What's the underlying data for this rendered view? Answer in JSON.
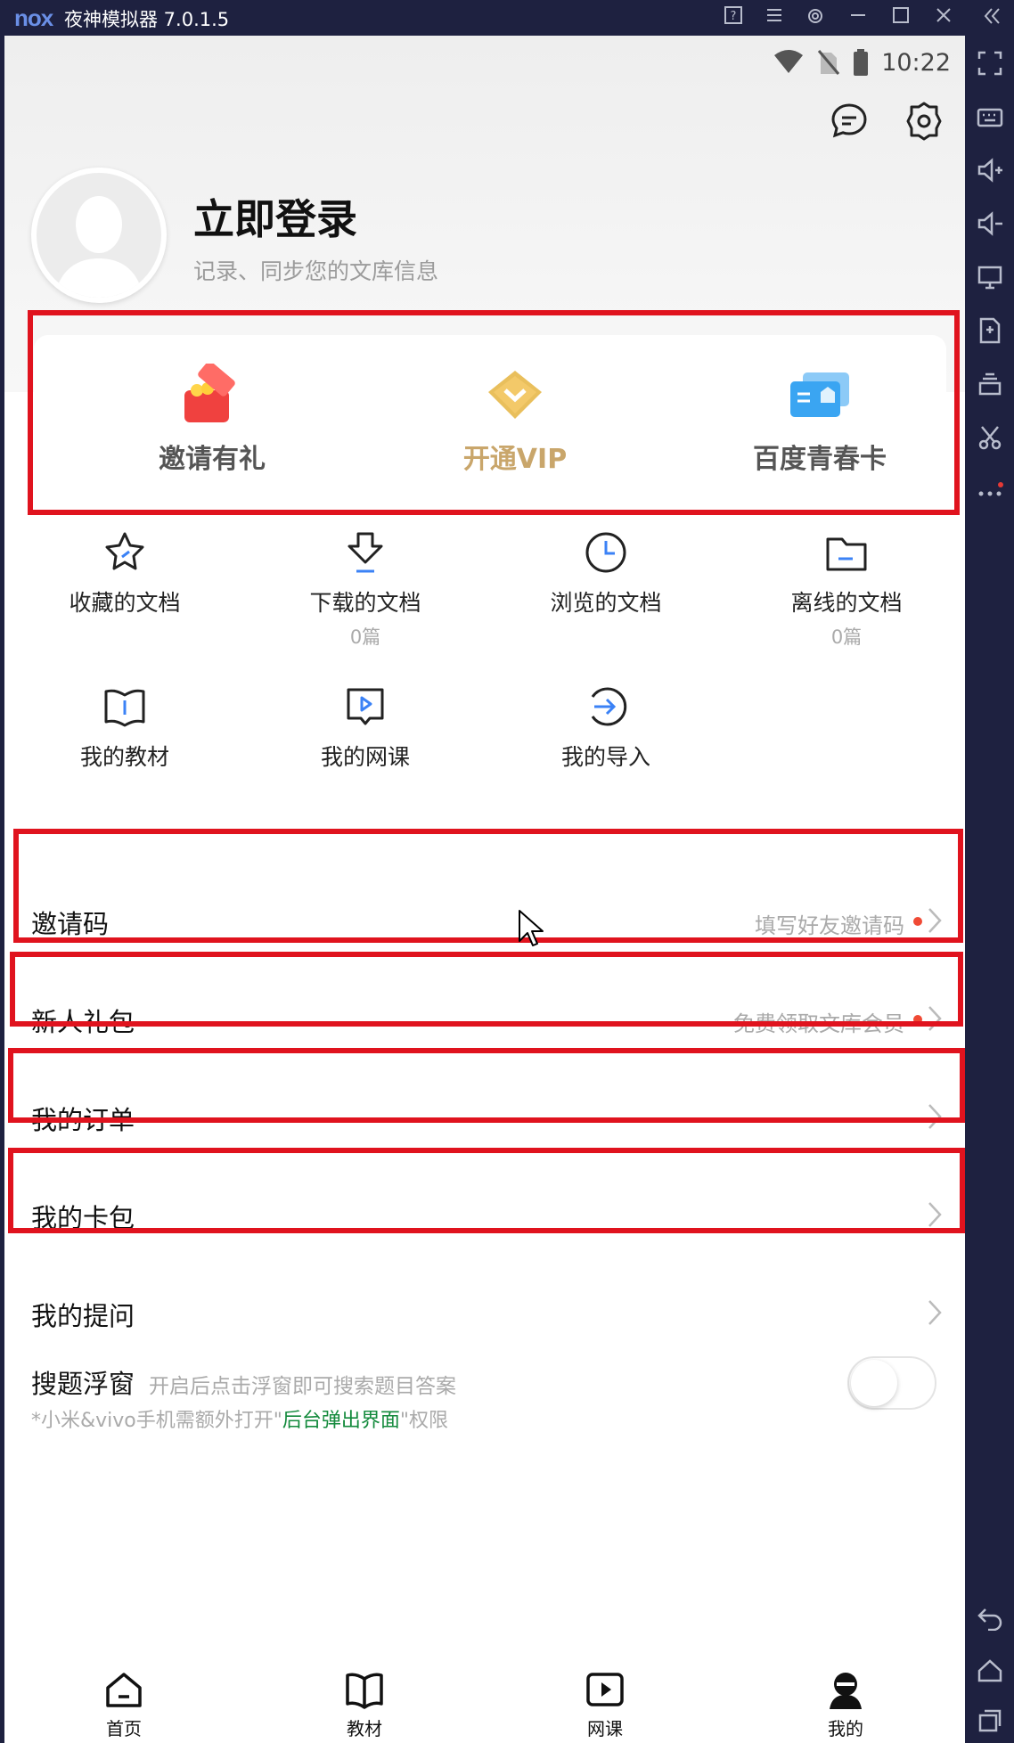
{
  "window": {
    "logo": "nox",
    "title": "夜神模拟器 7.0.1.5",
    "controls": [
      "help-icon",
      "menu-icon",
      "settings-icon",
      "minimize-icon",
      "maximize-icon",
      "close-icon",
      "collapse-icon"
    ]
  },
  "status": {
    "time": "10:22"
  },
  "header": {
    "login_title": "立即登录",
    "login_subtitle": "记录、同步您的文库信息"
  },
  "quick": [
    {
      "label": "邀请有礼",
      "icon": "gift-box-icon",
      "color": "#555555"
    },
    {
      "label": "开通VIP",
      "icon": "vip-diamond-icon",
      "color": "#c9a66b"
    },
    {
      "label": "百度青春卡",
      "icon": "youth-card-icon",
      "color": "#555555"
    }
  ],
  "grid": [
    {
      "label": "收藏的文档",
      "count": "",
      "icon": "star-icon"
    },
    {
      "label": "下载的文档",
      "count": "0篇",
      "icon": "download-icon"
    },
    {
      "label": "浏览的文档",
      "count": "",
      "icon": "clock-icon"
    },
    {
      "label": "离线的文档",
      "count": "0篇",
      "icon": "folder-icon"
    },
    {
      "label": "我的教材",
      "count": "",
      "icon": "book-icon"
    },
    {
      "label": "我的网课",
      "count": "",
      "icon": "video-lesson-icon"
    },
    {
      "label": "我的导入",
      "count": "",
      "icon": "import-icon"
    }
  ],
  "rows": [
    {
      "label": "邀请码",
      "hint": "填写好友邀请码",
      "dot": true
    },
    {
      "label": "新人礼包",
      "hint": "免费领取文库会员",
      "dot": true
    },
    {
      "label": "我的订单",
      "hint": "",
      "dot": false
    },
    {
      "label": "我的卡包",
      "hint": "",
      "dot": false
    },
    {
      "label": "我的提问",
      "hint": "",
      "dot": false
    }
  ],
  "float_window": {
    "title": "搜题浮窗",
    "desc": "开启后点击浮窗即可搜索题目答案",
    "note_pre": "*小米&vivo手机需额外打开\"",
    "note_highlight": "后台弹出界面",
    "note_post": "\"权限",
    "enabled": false
  },
  "tabs": [
    {
      "label": "首页",
      "icon": "home-icon"
    },
    {
      "label": "教材",
      "icon": "book-open-icon"
    },
    {
      "label": "网课",
      "icon": "play-icon"
    },
    {
      "label": "我的",
      "icon": "profile-icon",
      "active": true
    }
  ],
  "colors": {
    "accent": "#3b82f6",
    "highlight_box": "#e0131e",
    "vip_gold": "#c9a66b",
    "dot": "#f04a35"
  }
}
